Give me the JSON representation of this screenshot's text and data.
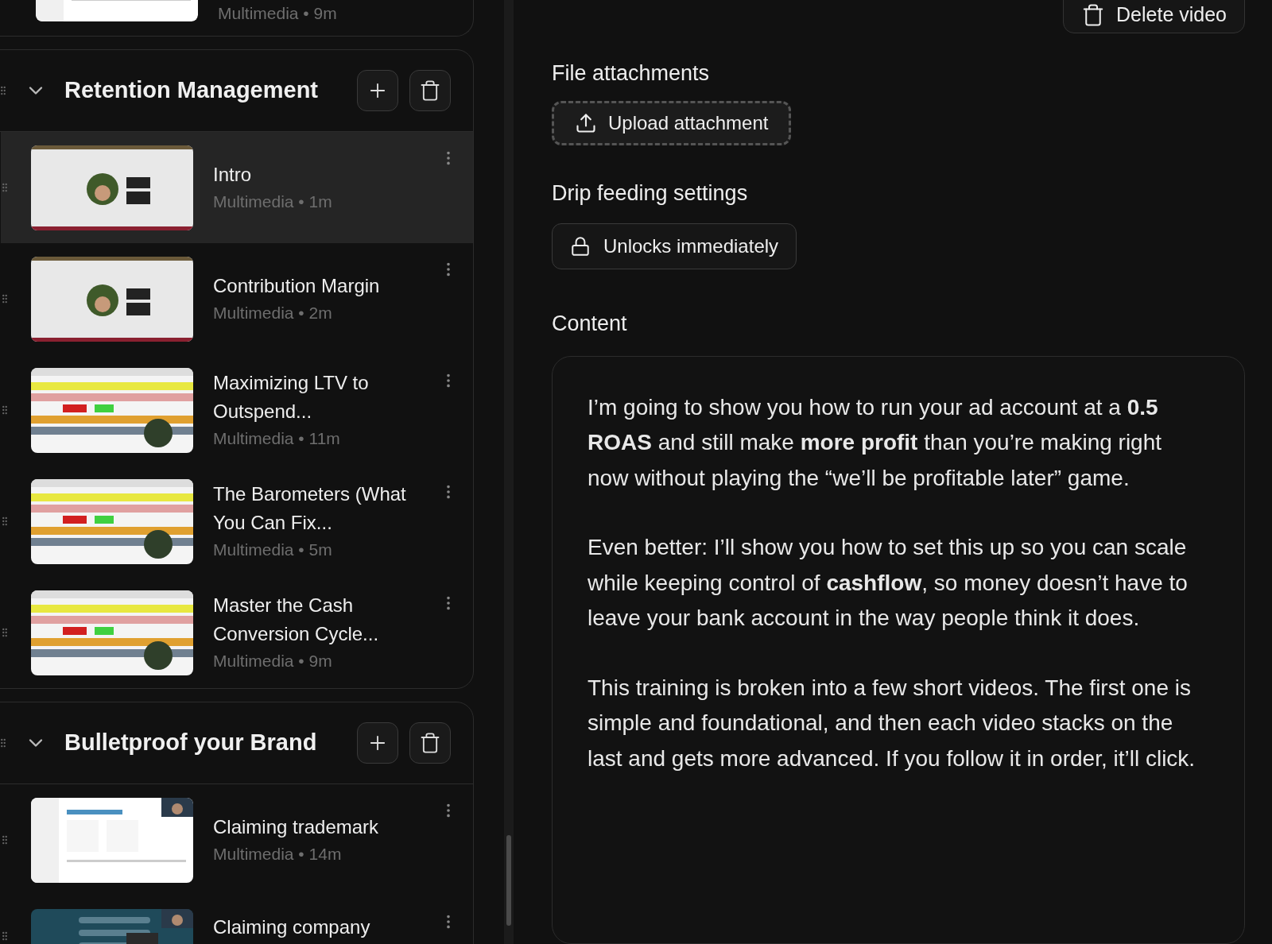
{
  "partial_card": {
    "items": [
      {
        "meta": "Multimedia • 9m"
      }
    ]
  },
  "sections": [
    {
      "title": "Retention Management",
      "expanded": true,
      "items": [
        {
          "title": "Intro",
          "meta": "Multimedia • 1m",
          "selected": true
        },
        {
          "title": "Contribution Margin",
          "meta": "Multimedia • 2m",
          "selected": false
        },
        {
          "title": "Maximizing LTV to Outspend...",
          "meta": "Multimedia • 11m",
          "selected": false
        },
        {
          "title": "The Barometers (What You Can Fix...",
          "meta": "Multimedia • 5m",
          "selected": false
        },
        {
          "title": "Master the Cash Conversion Cycle...",
          "meta": "Multimedia • 9m",
          "selected": false
        }
      ]
    },
    {
      "title": "Bulletproof your Brand",
      "expanded": true,
      "items": [
        {
          "title": "Claiming trademark",
          "meta": "Multimedia • 14m",
          "selected": false
        },
        {
          "title": "Claiming company",
          "selected": false
        }
      ]
    }
  ],
  "delete_button": "Delete video",
  "attachments": {
    "heading": "File attachments",
    "button": "Upload attachment"
  },
  "drip": {
    "heading": "Drip feeding settings",
    "button": "Unlocks immediately"
  },
  "content": {
    "heading": "Content",
    "paragraphs": [
      "I’m going to show you how to run your ad account at a **0.5 ROAS** and still make **more profit** than you’re making right now without playing the “we’ll be profitable later” game.",
      "Even better: I’ll show you how to set this up so you can scale while keeping control of **cashflow**, so money doesn’t have to leave your bank account in the way people think it does.",
      "This training is broken into a few short videos. The first one is simple and foundational, and then each video stacks on the last and gets more advanced. If you follow it in order, it’ll click."
    ]
  }
}
